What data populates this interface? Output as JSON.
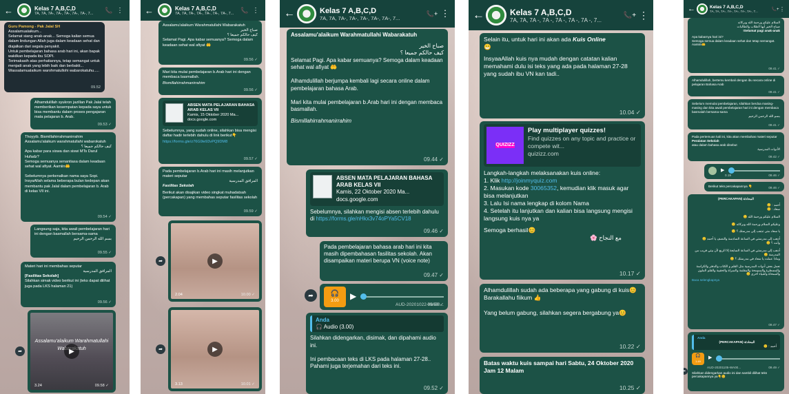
{
  "app": {
    "colors": {
      "header": "#16433c",
      "bubble_out": "#1c5246",
      "link": "#53bdeb",
      "audio_icon": "#f39c12"
    }
  },
  "group": {
    "title": "Kelas 7 A,B,C,D",
    "members": "7A, 7A, 7A-, 7A-, 7A-, 7A-, 7A-, 7...",
    "members_short": "7A, 7A, 7A -, 7A -, 7A -, 7A -, 7A -, 7..."
  },
  "icons": {
    "back": "←",
    "call": "📞",
    "add_call": "📞+",
    "menu": "⋮",
    "forward": "➦",
    "play": "▶",
    "audio": "🎧"
  },
  "p1": {
    "m1": {
      "sender": "Guru Pamong - Pak Jalal SH",
      "text": "Assalamualaikum...\nSelamat siang anak-anak... Semoga kalian semua dalam lindungan Allah juga dalam keadaan sehat dan diajalkan dari segala penyakit.\nUntuk pembelajaran bahasa arab hari ini, akan bapak wakilkan kepada ibu SOPI.\nTerimakasih atas perhatiannya, tetap semangat untuk menjadi anak yang lebih baik dan berbakti... Wassalamualaikum warohmatullohi wabarokatuhu.....",
      "time": "09.52"
    },
    "m2": {
      "text": "Alhamdulillah syukron jazillan Pak Jalal telah memberikan kesempatan kepada saya untuk bisa membantu dalam proses pengajaran mata pelajaran b. Arab.",
      "time": "09.53 ✓"
    },
    "m3": {
      "text": "Thoyyib. Bismillahirrahmanirrahim\nAssalamu'alaikum warahmatullahi wabarokatuh",
      "arabic": "كيف حالكم جميعا ؟",
      "text2": "Apa kabar para siswa dan siswi MTs Darul Hufadz?\nSemoga semuanya senantiasa dalam keadaan sehat wal afiyat. Aamiin🤲\n\nSebelumnya perkenalkan nama saya Sopi. InsyaAllah selama beberapa bulan kedepan akan membantu pak Jalal dalam pembelajaran b. Arab di kelas VII ini.",
      "time": "09.54 ✓"
    },
    "m4": {
      "text": "Langsung saja, kita awali pembelajaran hari ini dengan basmallah bersama-sama",
      "arabic": "بسم الله الرحمن الرحيم",
      "time": "09.55 ✓"
    },
    "m5": {
      "text": "Materi hari ini membahas seputar",
      "arabic": "المرافق المدرسية",
      "bold": "[Fasilitas Sekolah]",
      "text2": "Silahkan simak video berikut ini (teks dapat dilihat juga pada LKS halaman 21)",
      "time": "09.56 ✓"
    },
    "video": {
      "overlay": "Assalamu'alaikum Warahmatullahi Wabarakatuh",
      "length": "3.24",
      "time": "09.58 ✓"
    }
  },
  "p2": {
    "m1": {
      "text": "Assalamu'alaikum Warahmatullahi Wabarakatuh",
      "arabic": "صباح الخير\nكيف حالكم جميعا ؟",
      "text2": "Selamat Pagi. Apa kabar semuanya? Semoga dalam keadaan sehat wal afiyat 🤲",
      "time": "09.56 ✓"
    },
    "m2": {
      "text": "Mari kita mulai pembelajaran b.Arab hari ini dengan membaca basmallah.",
      "italic": "Bismillahirrahmanirrahim",
      "time": "09.56 ✓"
    },
    "m3": {
      "card_title": "ABSEN MATA PELAJARAN BAHASA ARAB KELAS VII",
      "card_date": "Kamis, 15 Oktober 2020 Ma...",
      "card_domain": "docs.google.com",
      "text": "Sebelumnya, yang sudah online, silahkan bisa mengisi daftar hadir terlebih dahulu di link berikut👇",
      "link": "https://forms.gle/z76G9ie93vPQ9DM8",
      "time": "09.57 ✓"
    },
    "m4": {
      "text": "Pada pembelajaran b.Arab hari ini masih melanjutkan materi seputar",
      "arabic": "المرافق المدرسية",
      "italic": "Fasilitas Sekolah",
      "text2": "Berikut akan disajikan video singkat muhadatsah (percakapan) yang membahas seputar fasilitas sekolah",
      "time": "09.59 ✓"
    },
    "v1": {
      "length": "2.04",
      "time": "10.00 ✓"
    },
    "v2": {
      "length": "3.13",
      "time": "10.01 ✓"
    }
  },
  "p3": {
    "m1": {
      "bold": "Assalamu'alaikum Warahmatullahi Wabarakatuh",
      "arabic": "صباح الخير\nكيف حالكم جميعا ؟",
      "text": "Selamat Pagi. Apa kabar semuanya? Semoga dalam keadaan sehat wal afiyat 🤲\n\nAlhamdulillah berjumpa kembali lagi secara online dalam pembelajaran bahasa Arab.\n\nMari kita mulai pembelajaran b.Arab hari ini dengan membaca basmallah.",
      "italic": "Bismillahirrahmanirrahim",
      "time": "09.44 ✓"
    },
    "m2": {
      "card_title": "ABSEN MATA PELAJARAN BAHASA ARAB KELAS VII",
      "card_date": "Kamis, 22 Oktober 2020 Ma...",
      "card_domain": "docs.google.com",
      "text": "Sebelumnya, silahkan mengisi absen terlebih dahulu di",
      "link": "https://forms.gle/nHkx3v74oPYa5CV18",
      "time": "09.46 ✓"
    },
    "m3": {
      "text": "Pada pembelajaran bahasa arab hari ini kita masih dipembahasan fasilitas sekolah. Akan disampaikan materi berupa VN (voice note)",
      "time": "09.47 ✓"
    },
    "audio": {
      "size": "3.00",
      "name": "AUD-20201022-WA00...",
      "time": "09.50 ✓"
    },
    "m4": {
      "quote_sender": "Anda",
      "quote_text": "🎧 Audio (3.00)",
      "text": "Silahkan didengarkan, disimak, dan dipahami audio ini.\n\nIni pembacaan teks di LKS pada halaman 27-28..\nPahami juga terjemahan dari teks ini.",
      "time": "09.52 ✓"
    }
  },
  "p4": {
    "m1": {
      "text": "Selain itu, untuk hari ini akan ada",
      "bold": "Kuis Online",
      "emoji": "😁",
      "text2": "InsyaaAllah kuis nya mudah dengan catatan kalian memahami dulu isi teks yang ada pada halaman 27-28 yang sudah ibu VN kan tadi..",
      "time": "10.04 ✓"
    },
    "m2": {
      "card_logo": "QUIZIZZ",
      "card_title": "Play multiplayer quizzes!",
      "card_desc": "Find quizzes on any topic and practice or compete wit...",
      "card_domain": "quizizz.com",
      "text": "Langkah-langkah melaksanakan kuis online:",
      "steps": [
        "1. Klik",
        "2. Masukan kode",
        ", kemudian klik masuk agar bisa melanjutkan",
        "3. Lalu Isi nama lengkap di kolom Nama",
        "4. Setelah itu lanjutkan dan kalian bisa langsung mengisi langsung kuis nya ya"
      ],
      "link": "http://joinmyquiz.com",
      "code": "30065352",
      "text2": "Semoga berhasil😊",
      "arabic": "مع النجاح 🌸",
      "time": "10.17 ✓"
    },
    "m3": {
      "text": "Alhamdulillah sudah ada beberapa yang gabung di kuis😊\nBarakallahu fiikum 👍\n\nYang belum gabung, silahkan segera bergabung ya😊",
      "time": "10.22 ✓"
    },
    "m4": {
      "bold": "Batas waktu kuis sampai hari Sabtu, 24 Oktober 2020 Jam 12 Malam",
      "time": "10.25 ✓"
    }
  },
  "p5": {
    "m1": {
      "arabic": "السلام عليكم ورحمة الله وبركاته\nصباح الخير أيها الطلاب والطالبات",
      "bold": "Selamat pagi anak-anak!",
      "text": "Apa kabarnya hari ini?\nSemoga semua dalam keadaan sehat dan tetap semangat.\nAamiin🤲",
      "time": "09.41 ✓"
    },
    "m2": {
      "text": "Alhamdulillah, bertemu kembali dengan ibu secara online di pelajaran Bahasa Arab",
      "time": "09.41 ✓"
    },
    "m3": {
      "text": "Sebelum memulai pembelajaran, silahkan berdoa masing-masing dan kita awali pembelajaran hari ini dengan membaca basmalah bersama-sama",
      "arabic": "بسم الله الرحمن الرحيم",
      "time": "09.41 ✓"
    },
    "m4": {
      "text": "Pada pertemuan kali ini, kita akan membahas materi seputar",
      "bold": "Peralatan Sekolah",
      "text2": "atau dalam bahasa arab disebut",
      "arabic": "الأدوات المدرسية",
      "time": "09.42 ✓"
    },
    "audio1": {
      "length": "0.19",
      "time": "09.46 ✓"
    },
    "m5": {
      "text": "Berikut teks percakapannya 👇",
      "time": "09.46 ✓"
    },
    "m6": {
      "title": "(PERCAKAPAN) المحادثة",
      "lines": [
        "أحمد : 🙂",
        "سعاد : 🙂",
        "السلام عليكم ورحمة الله 🙂",
        "وعليكم السلام ورحمة الله وبركاته 🙂",
        "يا سعاد متى تذهب إلى مدرستك ؟ 🙂",
        "أذهب إلى مدرستي في الساعة السادسة والنصف يا أحمد 🙂",
        "وأنت ؟ 🙂",
        "أذهب إلى مدرستي في الساعة السابعة إلا الربع لأن بيتي قريب من المدرسة 🙂",
        "وماذا عملت يا سعاد في مدرستك ؟ 🙂",
        "نعمل بعض أدوات المدرسية مثل القلم و الكتاب والدفتر والكراسة والمسطرة والممسحة والمقلمة والمبراة والحقيبة والقلم الملون والممحاة وأشياء أخرى 🙂"
      ],
      "more": "Baca selengkapnya",
      "time": "09.47 ✓"
    },
    "m7": {
      "quote_sender": "Anda",
      "quote_title": "(PERCAKAPAN) المحادثة",
      "quote_line": "أحمد : 🙂",
      "audio_len": "1.49",
      "audio_name": "AUD-20201105-WA00...",
      "audio_time": "09.49 ✓",
      "text": "Silahkan didengarkan audio ini dan sambil dilihat teks percakapannya ya👇😊"
    }
  }
}
